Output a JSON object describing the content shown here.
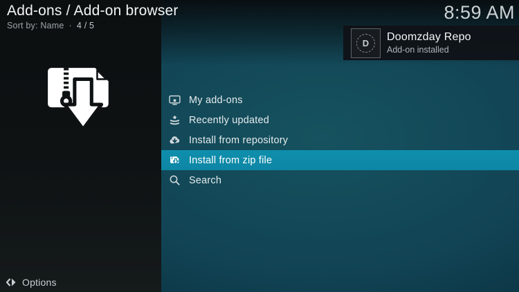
{
  "header": {
    "title": "Add-ons / Add-on browser",
    "sort_label": "Sort by: Name",
    "separator": "·",
    "position": "4 / 5"
  },
  "clock": "8:59 AM",
  "notification": {
    "title": "Doomzday Repo",
    "subtitle": "Add-on installed",
    "icon": "doomzday-repo-logo",
    "icon_letter": "D"
  },
  "menu": {
    "items": [
      {
        "label": "My add-ons",
        "icon": "addons-monitor-icon",
        "selected": false
      },
      {
        "label": "Recently updated",
        "icon": "recently-updated-stack-icon",
        "selected": false
      },
      {
        "label": "Install from repository",
        "icon": "cloud-download-icon",
        "selected": false
      },
      {
        "label": "Install from zip file",
        "icon": "zip-file-icon",
        "selected": true
      },
      {
        "label": "Search",
        "icon": "search-icon",
        "selected": false
      }
    ]
  },
  "left_panel": {
    "icon": "zip-file-download-icon"
  },
  "footer": {
    "options_label": "Options",
    "icon": "options-icon"
  },
  "colors": {
    "highlight": "#0d87a5",
    "menu_text": "#e4ebed",
    "left_panel_bg": "#0e1213",
    "toast_bg": "#101318",
    "background_teal": "#114354",
    "clock_text": "#ccd3d5"
  }
}
